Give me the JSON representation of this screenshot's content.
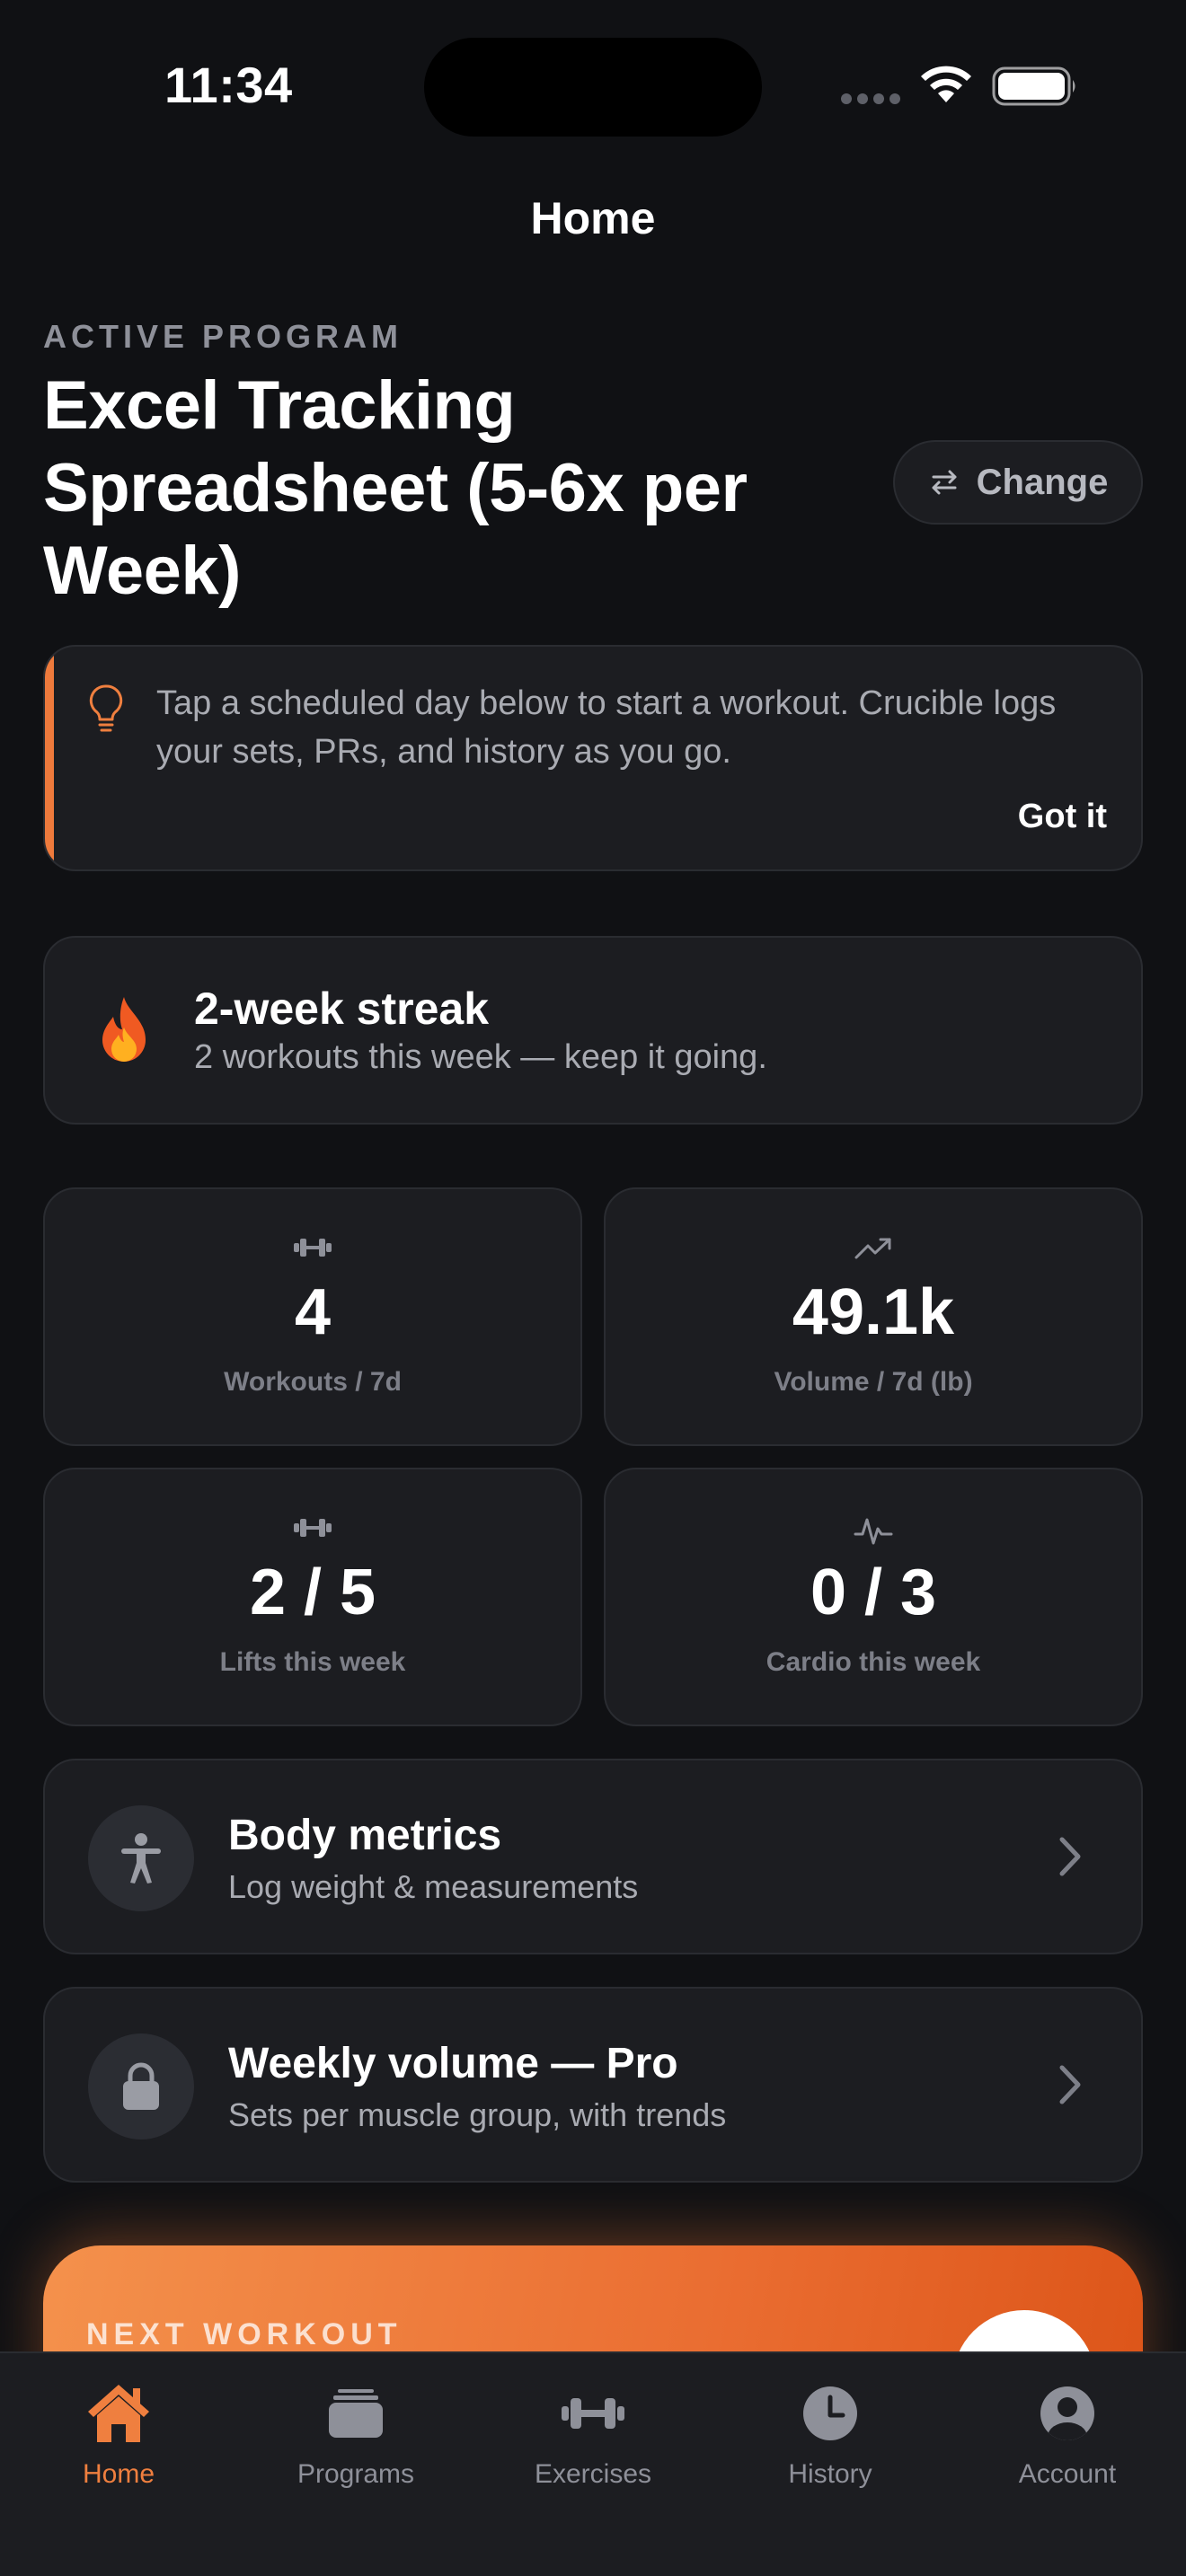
{
  "status_bar": {
    "time": "11:34",
    "icons": [
      "signal-dots-icon",
      "wifi-icon",
      "battery-icon"
    ]
  },
  "nav": {
    "title": "Home"
  },
  "program": {
    "eyebrow": "ACTIVE PROGRAM",
    "title": "Excel Tracking Spreadsheet (5-6x per Week)",
    "change_label": "Change"
  },
  "tip": {
    "text": "Tap a scheduled day below to start a workout. Crucible logs your sets, PRs, and history as you go.",
    "dismiss_label": "Got it",
    "icon": "lightbulb-icon"
  },
  "streak": {
    "title": "2-week streak",
    "subtitle": "2 workouts this week — keep it going.",
    "icon": "flame-icon"
  },
  "stats": [
    {
      "value": "4",
      "label": "Workouts / 7d",
      "icon": "dumbbell-icon"
    },
    {
      "value": "49.1k",
      "label": "Volume / 7d (lb)",
      "icon": "trend-up-icon"
    },
    {
      "value": "2 / 5",
      "label": "Lifts this week",
      "icon": "dumbbell-icon"
    },
    {
      "value": "0 / 3",
      "label": "Cardio this week",
      "icon": "heartbeat-icon"
    }
  ],
  "rows": [
    {
      "title": "Body metrics",
      "subtitle": "Log weight & measurements",
      "icon": "person-icon"
    },
    {
      "title": "Weekly volume — Pro",
      "subtitle": "Sets per muscle group, with trends",
      "icon": "lock-icon"
    }
  ],
  "next_workout": {
    "label": "NEXT WORKOUT"
  },
  "tabs": [
    {
      "label": "Home",
      "icon": "house-icon",
      "active": true
    },
    {
      "label": "Programs",
      "icon": "stack-icon",
      "active": false
    },
    {
      "label": "Exercises",
      "icon": "dumbbell-icon",
      "active": false
    },
    {
      "label": "History",
      "icon": "clock-icon",
      "active": false
    },
    {
      "label": "Account",
      "icon": "person-circle-icon",
      "active": false
    }
  ],
  "colors": {
    "background": "#101114",
    "card": "#1c1d21",
    "accent": "#ef7f3f",
    "muted_text": "#8e9099"
  }
}
